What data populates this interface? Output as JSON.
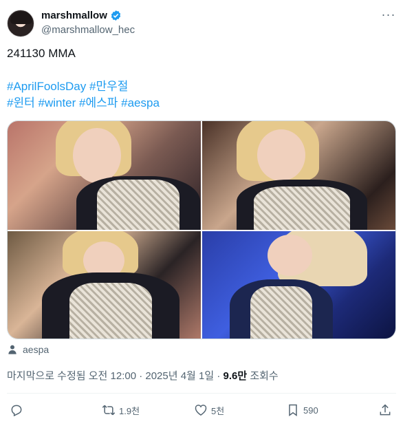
{
  "author": {
    "display_name": "marshmallow",
    "handle": "@marshmallow_hec",
    "verified": true,
    "avatar_icon": "avatar-photo"
  },
  "tweet": {
    "lines": [
      "241130 MMA",
      "",
      "#AprilFoolsDay #만우절",
      "#윈터 #winter #에스파 #aespa"
    ]
  },
  "hashtags": {
    "line1": [
      "#AprilFoolsDay",
      "#만우절"
    ],
    "line2": [
      "#윈터",
      "#winter",
      "#에스파",
      "#aespa"
    ]
  },
  "media": {
    "photos": [
      "photo-1",
      "photo-2",
      "photo-3",
      "photo-4"
    ]
  },
  "tagged": {
    "label": "aespa",
    "icon": "person-icon"
  },
  "meta": {
    "edited_prefix": "마지막으로 수정됨 오전 12:00 · 2025년 4월 1일 · ",
    "views_count": "9.6만",
    "views_suffix": " 조회수"
  },
  "actions": {
    "reply_count": "",
    "retweet_count": "1.9천",
    "like_count": "5천",
    "bookmark_count": "590"
  },
  "colors": {
    "accent": "#1d9bf0",
    "text": "#0f1419",
    "secondary": "#536471",
    "border": "#cfd9de"
  }
}
